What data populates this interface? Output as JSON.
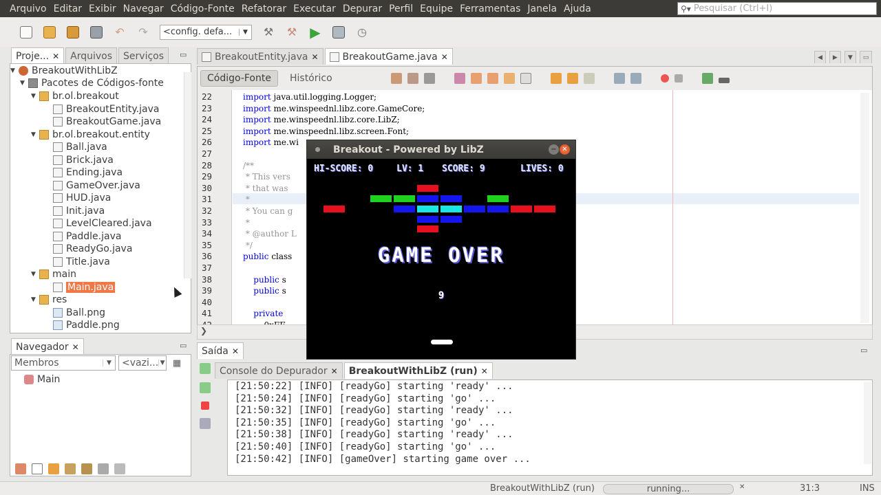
{
  "menu": [
    "Arquivo",
    "Editar",
    "Exibir",
    "Navegar",
    "Código-Fonte",
    "Refatorar",
    "Executar",
    "Depurar",
    "Perfil",
    "Equipe",
    "Ferramentas",
    "Janela",
    "Ajuda"
  ],
  "search": {
    "placeholder": "Pesquisar (Ctrl+I)"
  },
  "toolbar": {
    "config": "<config. defa..."
  },
  "left_tabs": [
    {
      "label": "Proje...",
      "closable": true,
      "active": true
    },
    {
      "label": "Arquivos",
      "closable": false,
      "active": false
    },
    {
      "label": "Serviços",
      "closable": false,
      "active": false
    }
  ],
  "tree": [
    {
      "label": "BreakoutWithLibZ",
      "type": "project"
    },
    {
      "label": "Pacotes de Códigos-fonte",
      "type": "src"
    },
    {
      "label": "br.ol.breakout",
      "type": "package"
    },
    {
      "label": "BreakoutEntity.java",
      "type": "file"
    },
    {
      "label": "BreakoutGame.java",
      "type": "file"
    },
    {
      "label": "br.ol.breakout.entity",
      "type": "package"
    },
    {
      "label": "Ball.java",
      "type": "file"
    },
    {
      "label": "Brick.java",
      "type": "file"
    },
    {
      "label": "Ending.java",
      "type": "file"
    },
    {
      "label": "GameOver.java",
      "type": "file"
    },
    {
      "label": "HUD.java",
      "type": "file"
    },
    {
      "label": "Init.java",
      "type": "file"
    },
    {
      "label": "LevelCleared.java",
      "type": "file"
    },
    {
      "label": "Paddle.java",
      "type": "file"
    },
    {
      "label": "ReadyGo.java",
      "type": "file"
    },
    {
      "label": "Title.java",
      "type": "file"
    },
    {
      "label": "main",
      "type": "package"
    },
    {
      "label": "Main.java",
      "type": "file",
      "selected": true
    },
    {
      "label": "res",
      "type": "package"
    },
    {
      "label": "Ball.png",
      "type": "image"
    },
    {
      "label": "Paddle.png",
      "type": "image"
    }
  ],
  "navigator": {
    "tab": "Navegador",
    "combo1": "Membros",
    "combo2": "<vazi...",
    "item": "Main"
  },
  "editor_tabs": [
    {
      "label": "BreakoutEntity.java",
      "active": false
    },
    {
      "label": "BreakoutGame.java",
      "active": true
    }
  ],
  "editor_modes": {
    "source": "Código-Fonte",
    "history": "Histórico"
  },
  "code_lines": [
    {
      "n": "22",
      "text": "import java.util.logging.Logger;",
      "kind": "import"
    },
    {
      "n": "23",
      "text": "import me.winspeednl.libz.core.GameCore;",
      "kind": "import"
    },
    {
      "n": "24",
      "text": "import me.winspeednl.libz.core.LibZ;",
      "kind": "import"
    },
    {
      "n": "25",
      "text": "import me.winspeednl.libz.screen.Font;",
      "kind": "import"
    },
    {
      "n": "26",
      "text": "import me.wi",
      "kind": "import"
    },
    {
      "n": "27",
      "text": "",
      "kind": "plain"
    },
    {
      "n": "28",
      "text": "/**",
      "kind": "comment"
    },
    {
      "n": "29",
      "text": " * This vers                                                       me library",
      "kind": "comment"
    },
    {
      "n": "30",
      "text": " * that was",
      "kind": "comment"
    },
    {
      "n": "31",
      "text": " *",
      "kind": "comment"
    },
    {
      "n": "32",
      "text": " * You can g",
      "kind": "comment"
    },
    {
      "n": "33",
      "text": " *",
      "kind": "comment"
    },
    {
      "n": "34",
      "text": " * @author L",
      "kind": "comment"
    },
    {
      "n": "35",
      "text": " */",
      "kind": "comment"
    },
    {
      "n": "36",
      "text": "public class",
      "kind": "keyword"
    },
    {
      "n": "37",
      "text": "",
      "kind": "plain"
    },
    {
      "n": "38",
      "text": "    public s                                                     = 300;",
      "kind": "keyword"
    },
    {
      "n": "39",
      "text": "    public s                                                     ;",
      "kind": "keyword"
    },
    {
      "n": "40",
      "text": "",
      "kind": "plain"
    },
    {
      "n": "41",
      "text": "    private",
      "kind": "keyword"
    },
    {
      "n": "42",
      "text": "        0xFF                                                  FFFF, 0xFFFF00FF,",
      "kind": "plain"
    }
  ],
  "output": {
    "title": "Saída",
    "tabs": [
      {
        "label": "Console do Depurador",
        "active": false
      },
      {
        "label": "BreakoutWithLibZ (run)",
        "active": true
      }
    ],
    "lines": [
      "[21:50:22] [INFO] [readyGo] starting 'ready' ...",
      "[21:50:24] [INFO] [readyGo] starting 'go' ...",
      "[21:50:32] [INFO] [readyGo] starting 'ready' ...",
      "[21:50:35] [INFO] [readyGo] starting 'go' ...",
      "[21:50:38] [INFO] [readyGo] starting 'ready' ...",
      "[21:50:40] [INFO] [readyGo] starting 'go' ...",
      "[21:50:42] [INFO] [gameOver] starting game over ..."
    ]
  },
  "status": {
    "task": "BreakoutWithLibZ (run)",
    "progress": "running...",
    "position": "31:3",
    "mode": "INS"
  },
  "game": {
    "title": "Breakout - Powered by LibZ",
    "hiscore": "HI-SCORE: 0",
    "level": "LV: 1",
    "score": "SCORE: 9",
    "lives": "LIVES: 0",
    "gameover": "GAME OVER",
    "final_score": "9",
    "colors": {
      "red": "#e8101e",
      "green": "#1fd21f",
      "blue": "#1515f0",
      "cyan": "#1ae6e6"
    }
  }
}
